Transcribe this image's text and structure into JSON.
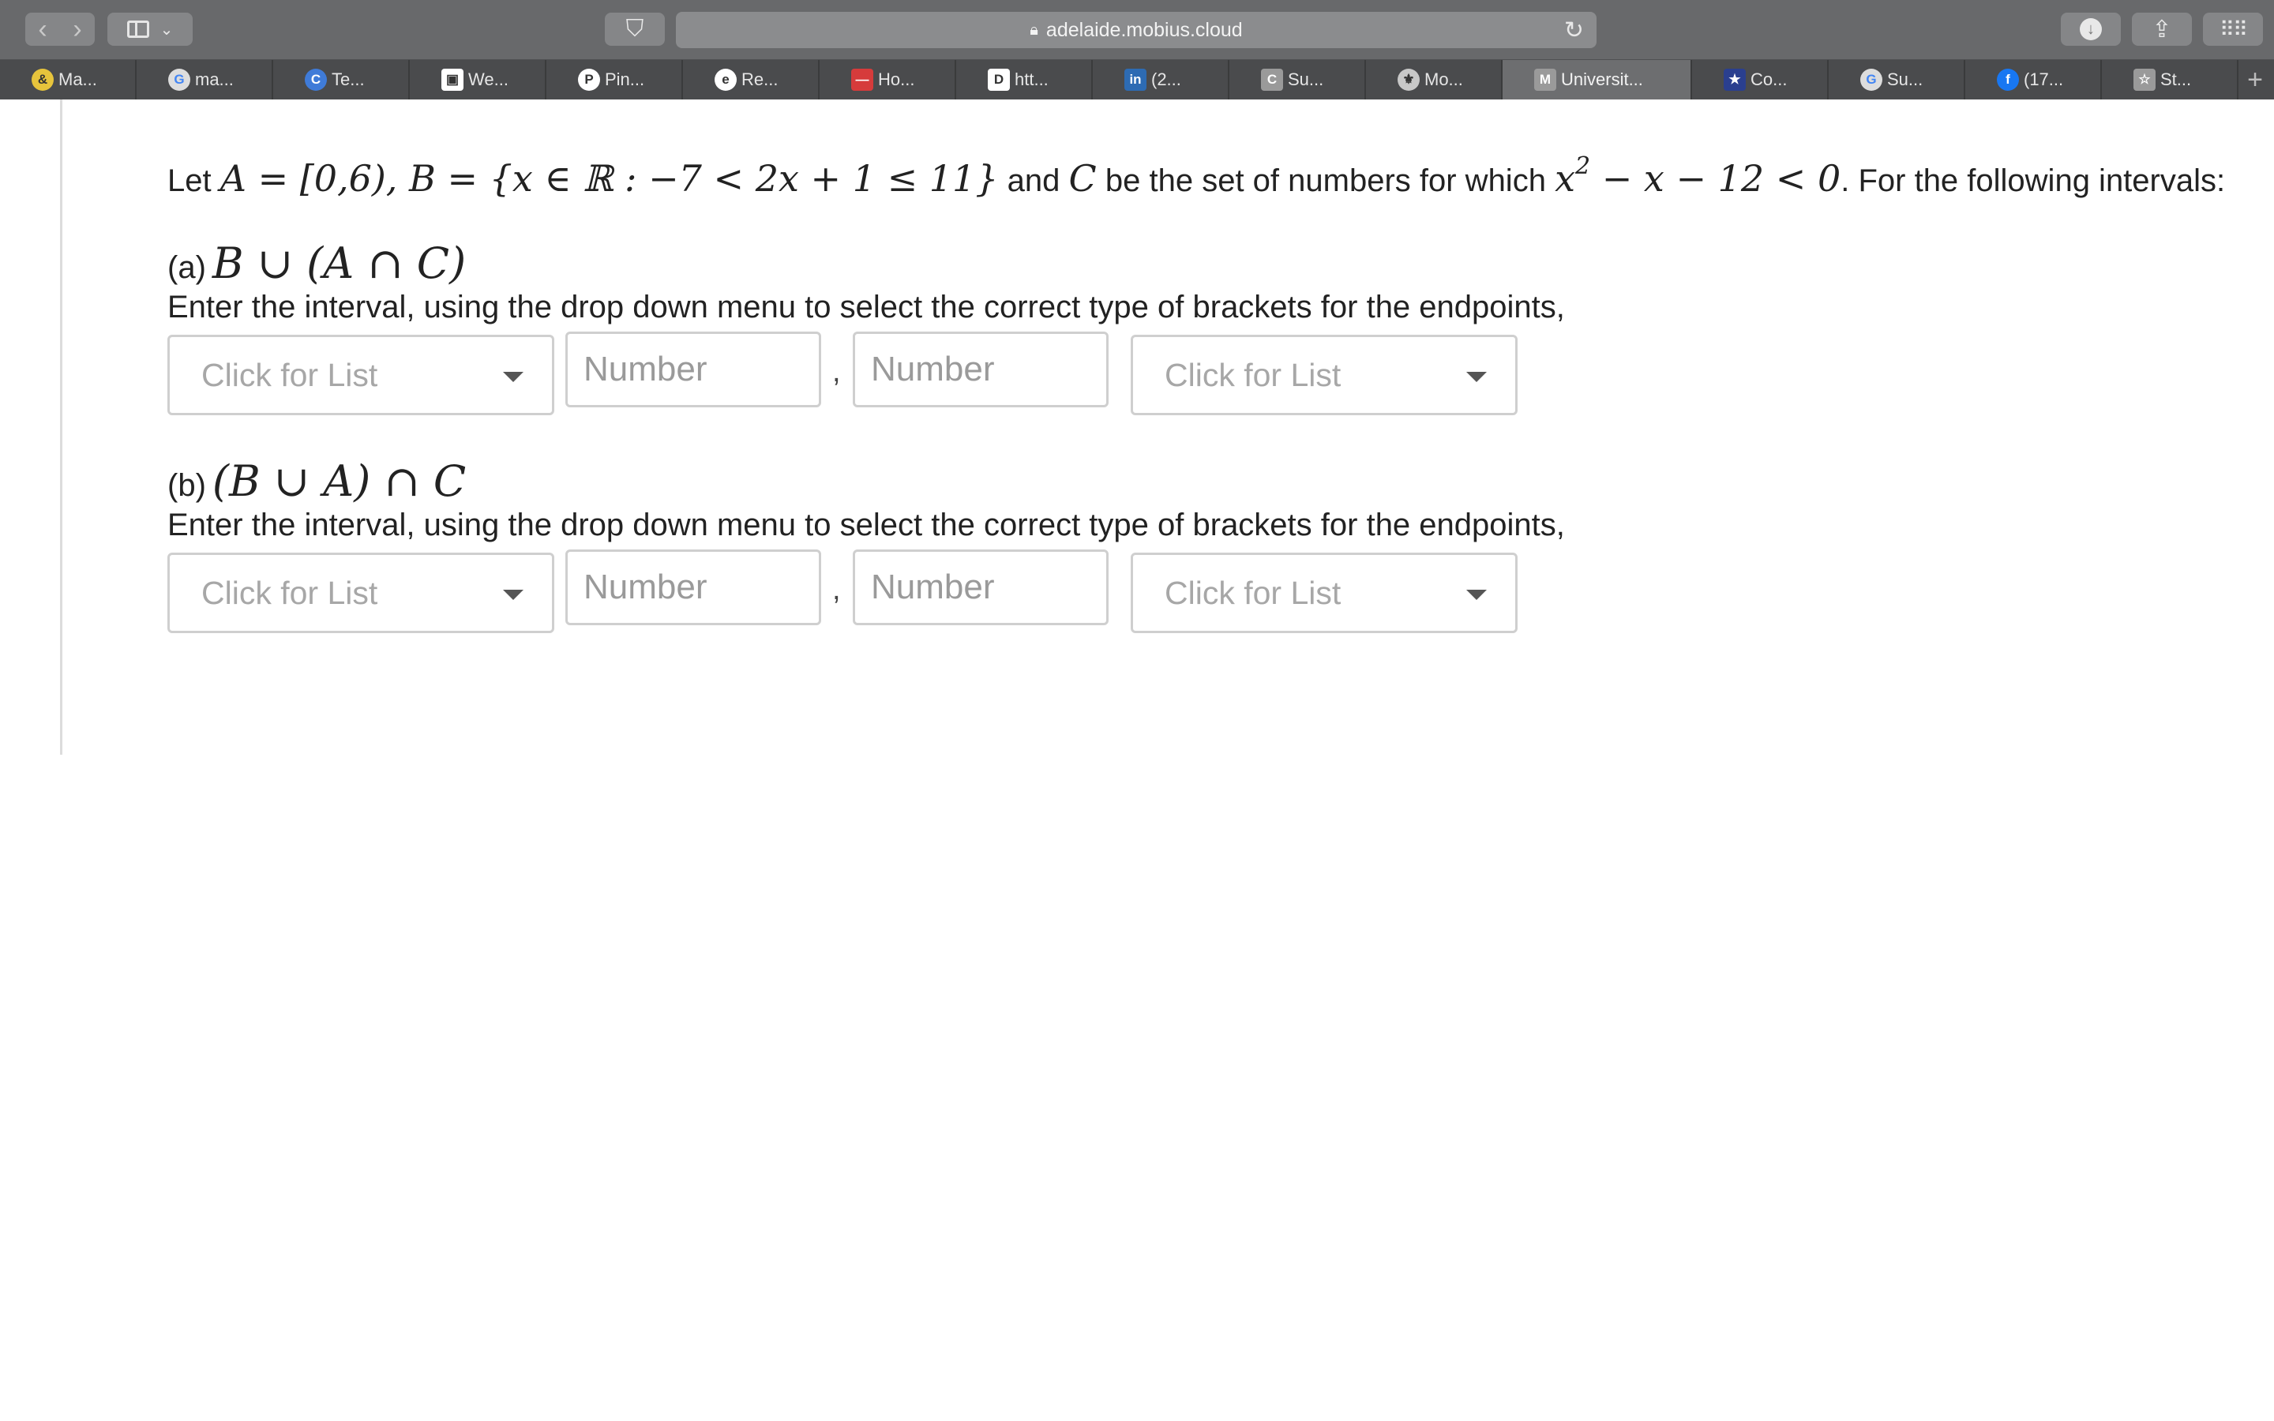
{
  "browser": {
    "url": "adelaide.mobius.cloud",
    "tabs": [
      {
        "label": "Ma...",
        "icon": "&",
        "icon_bg": "#e7c43c"
      },
      {
        "label": "ma...",
        "icon": "G",
        "icon_bg": "#ffffff"
      },
      {
        "label": "Te...",
        "icon": "C",
        "icon_bg": "#3f7bd8"
      },
      {
        "label": "We...",
        "icon": "▣",
        "icon_bg": "#ffffff"
      },
      {
        "label": "Pin...",
        "icon": "P",
        "icon_bg": "#ffffff"
      },
      {
        "label": "Re...",
        "icon": "e",
        "icon_bg": "#ffffff"
      },
      {
        "label": "Ho...",
        "icon": "—",
        "icon_bg": "#d63b3b"
      },
      {
        "label": "htt...",
        "icon": "D",
        "icon_bg": "#ffffff"
      },
      {
        "label": "(2...",
        "icon": "in",
        "icon_bg": "#2d6bb3"
      },
      {
        "label": "Su...",
        "icon": "C",
        "icon_bg": "#9a9a9a"
      },
      {
        "label": "Mo...",
        "icon": "⚜",
        "icon_bg": "#c8c8c8"
      },
      {
        "label": "Universit...",
        "icon": "M",
        "icon_bg": "#9a9a9a"
      },
      {
        "label": "Co...",
        "icon": "★",
        "icon_bg": "#2a3f8f"
      },
      {
        "label": "Su...",
        "icon": "G",
        "icon_bg": "#ffffff"
      },
      {
        "label": "(17...",
        "icon": "f",
        "icon_bg": "#1877f2"
      },
      {
        "label": "St...",
        "icon": "☆",
        "icon_bg": "#9a9a9a"
      }
    ]
  },
  "question": {
    "statement": {
      "t_let": "Let",
      "m_sets": "A = [0,6), B = {x ∈ ℝ : −7 < 2x + 1 ≤ 11}",
      "t_and": "and",
      "m_c": "C",
      "t_mid": "be the set of numbers for which",
      "m_x": "x",
      "m_exp": "2",
      "m_rest": " − x − 12 < 0",
      "t_end": ". For the following intervals:"
    },
    "parts": [
      {
        "label": "(a)",
        "expression": "B ∪ (A ∩ C)",
        "instruction": "Enter the interval, using the drop down menu to select the correct type of brackets for the endpoints,",
        "left_bracket_select": "Click for List",
        "left_number_placeholder": "Number",
        "separator": ",",
        "right_number_placeholder": "Number",
        "right_bracket_select": "Click for List"
      },
      {
        "label": "(b)",
        "expression": "(B ∪ A) ∩ C",
        "instruction": "Enter the interval, using the drop down menu to select the correct type of brackets for the endpoints,",
        "left_bracket_select": "Click for List",
        "left_number_placeholder": "Number",
        "separator": ",",
        "right_number_placeholder": "Number",
        "right_bracket_select": "Click for List"
      }
    ]
  }
}
